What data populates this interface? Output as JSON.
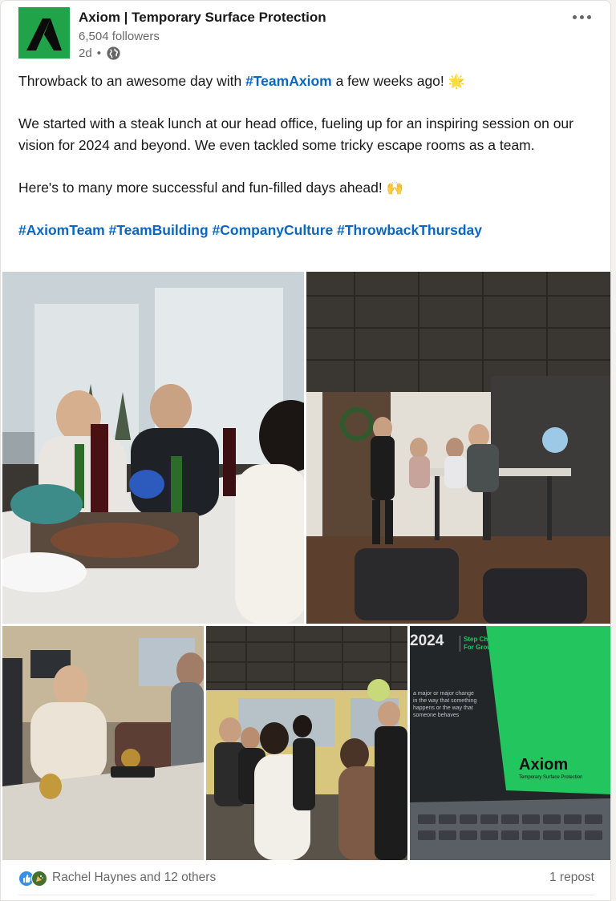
{
  "post": {
    "author": {
      "name": "Axiom | Temporary Surface Protection",
      "followers": "6,504 followers",
      "time": "2d",
      "visibility_icon": "globe-icon",
      "logo_color": "#21a34a"
    },
    "text": {
      "line1_before": "Throwback to an awesome day with ",
      "line1_hashtag": "#TeamAxiom",
      "line1_after": " a few weeks ago! ",
      "line1_emoji": "🌟",
      "paragraph2": "We started with a steak lunch at our head office, fueling up for an inspiring session on our vision for 2024 and beyond. We even tackled some tricky escape rooms as a team.",
      "paragraph3": "Here's to many more successful and fun-filled days ahead! ",
      "paragraph3_emoji": "🙌",
      "hashtags": [
        "#AxiomTeam",
        "#TeamBuilding",
        "#CompanyCulture",
        "#ThrowbackThursday"
      ]
    },
    "photos": {
      "laptop_screen": {
        "year": "2024",
        "tagline_line1": "Step Change",
        "tagline_line2": "For Growth",
        "definition": [
          "a major or major change",
          "in the way that something",
          "happens or the way that",
          "someone behaves"
        ],
        "brand": "Axiom",
        "brand_sub": "Temporary Surface Protection"
      }
    },
    "social": {
      "reactions_text": "Rachel Haynes and 12 others",
      "reposts": "1 repost",
      "reaction_icons": [
        "like-icon",
        "celebrate-icon"
      ]
    }
  },
  "colors": {
    "link": "#0a66c2",
    "secondary_text": "rgba(0,0,0,0.6)",
    "brand_green": "#21a34a"
  }
}
